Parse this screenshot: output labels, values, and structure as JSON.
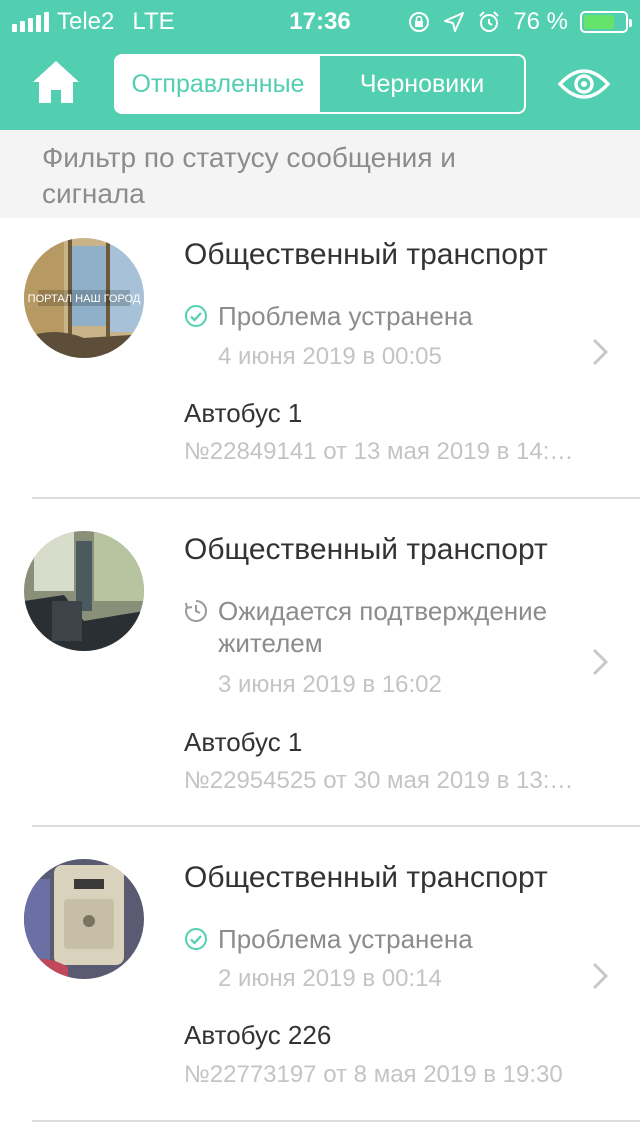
{
  "status_bar": {
    "carrier": "Tele2",
    "network": "LTE",
    "time": "17:36",
    "battery_percent": "76 %",
    "battery_level": 0.76
  },
  "header": {
    "tabs": [
      {
        "label": "Отправленные",
        "active": true
      },
      {
        "label": "Черновики",
        "active": false
      }
    ],
    "accent_color": "#52cfb0"
  },
  "filter": {
    "label": "Фильтр по статусу сообщения и сигнала"
  },
  "messages": [
    {
      "category": "Общественный транспорт",
      "status_icon": "check-circle-icon",
      "status": "Проблема устранена",
      "status_date": "4 июня 2019 в 00:05",
      "subject": "Автобус 1",
      "number": "№22849141 от 13 мая 2019 в 14:…",
      "photo_watermark": "ПОРТАЛ НАШ ГОРОД"
    },
    {
      "category": "Общественный транспорт",
      "status_icon": "clock-icon",
      "status": "Ожидается подтверждение жителем",
      "status_date": "3 июня 2019 в 16:02",
      "subject": "Автобус 1",
      "number": "№22954525 от 30 мая 2019 в 13:…"
    },
    {
      "category": "Общественный транспорт",
      "status_icon": "check-circle-icon",
      "status": "Проблема устранена",
      "status_date": "2 июня 2019 в 00:14",
      "subject": "Автобус 226",
      "number": "№22773197 от 8 мая 2019 в 19:30"
    }
  ]
}
